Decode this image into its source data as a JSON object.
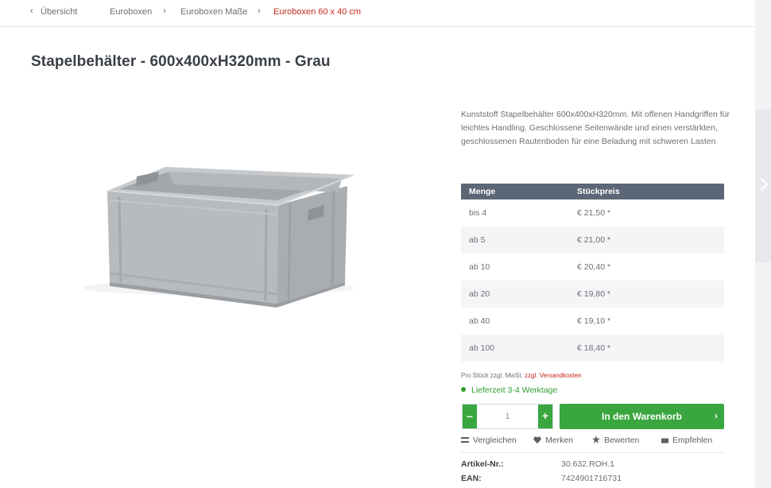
{
  "breadcrumb": {
    "back": "Übersicht",
    "items": [
      "Euroboxen",
      "Euroboxen Maße",
      "Euroboxen 60 x 40 cm"
    ]
  },
  "product": {
    "title": "Stapelbehälter - 600x400xH320mm - Grau",
    "description": "Kunststoff Stapelbehälter 600x400xH320mm. Mit offenen Handgriffen für leichtes Handling. Geschlossene Seitenwände und einen verstärkten, geschlossenen Rautenboden für eine Beladung mit schweren Lasten"
  },
  "price_table": {
    "headers": [
      "Menge",
      "Stückpreis"
    ],
    "rows": [
      [
        "bis 4",
        "€ 21,50 *"
      ],
      [
        "ab 5",
        "€ 21,00 *"
      ],
      [
        "ab 10",
        "€ 20,40 *"
      ],
      [
        "ab 20",
        "€ 19,80 *"
      ],
      [
        "ab 40",
        "€ 19,10 *"
      ],
      [
        "ab 100",
        "€ 18,40 *"
      ]
    ]
  },
  "tax_note": {
    "text": "Pro Stück zzgl. MwSt. ",
    "link": "zzgl. Versandkosten"
  },
  "delivery": "Lieferzeit 3-4 Werktage",
  "quantity": {
    "value": "1",
    "minus": "–",
    "plus": "+"
  },
  "cart_button": "In den Warenkorb",
  "actions": {
    "compare": "Vergleichen",
    "wishlist": "Merken",
    "rate": "Bewerten",
    "recommend": "Empfehlen"
  },
  "details": {
    "article_label": "Artikel-Nr.:",
    "article_value": "30.632.ROH.1",
    "ean_label": "EAN:",
    "ean_value": "7424901716731"
  },
  "colors": {
    "accent_red": "#c2281e",
    "green": "#3aa63f",
    "table_header": "#5b6676",
    "product_grey": "#b9bcbf"
  }
}
